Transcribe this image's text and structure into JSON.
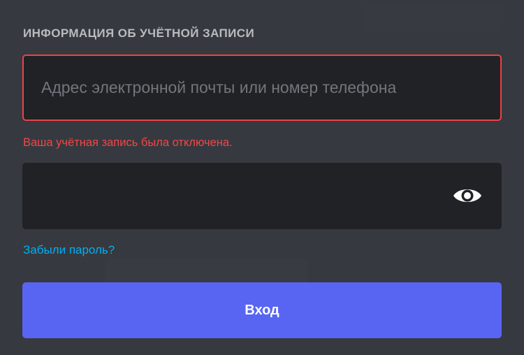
{
  "login_form": {
    "section_title": "ИНФОРМАЦИЯ ОБ УЧЁТНОЙ ЗАПИСИ",
    "email_placeholder": "Адрес электронной почты или номер телефона",
    "email_value": "",
    "error_message": "Ваша учётная запись была отключена.",
    "password_value": "",
    "password_toggle_icon": "eye-icon",
    "forgot_password_link": "Забыли пароль?",
    "submit_label": "Вход"
  },
  "colors": {
    "background": "#36393f",
    "input_background": "#202225",
    "error": "#ed4245",
    "link": "#00aff4",
    "brand": "#5865f2"
  }
}
